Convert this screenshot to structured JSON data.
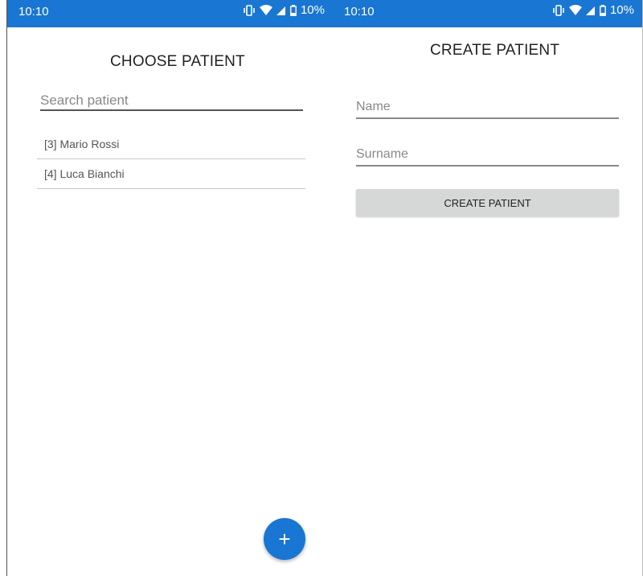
{
  "left_screen": {
    "status": {
      "time": "10:10",
      "battery": "10%"
    },
    "title": "CHOOSE PATIENT",
    "search": {
      "placeholder": "Search patient",
      "value": ""
    },
    "patients": [
      {
        "label": "[3] Mario Rossi"
      },
      {
        "label": "[4] Luca Bianchi"
      }
    ],
    "fab": {
      "label": "+",
      "icon": "plus-icon"
    }
  },
  "right_screen": {
    "status": {
      "time": "10:10",
      "battery": "10%"
    },
    "title": "CREATE PATIENT",
    "name_field": {
      "placeholder": "Name",
      "value": ""
    },
    "surname_field": {
      "placeholder": "Surname",
      "value": ""
    },
    "create_button": {
      "label": "CREATE PATIENT"
    }
  },
  "colors": {
    "statusbar": "#1976d2",
    "fab": "#1976d2",
    "button": "#d6d7d7"
  },
  "icons": [
    "vibrate-icon",
    "wifi-icon",
    "signal-icon",
    "battery-icon",
    "plus-icon"
  ]
}
